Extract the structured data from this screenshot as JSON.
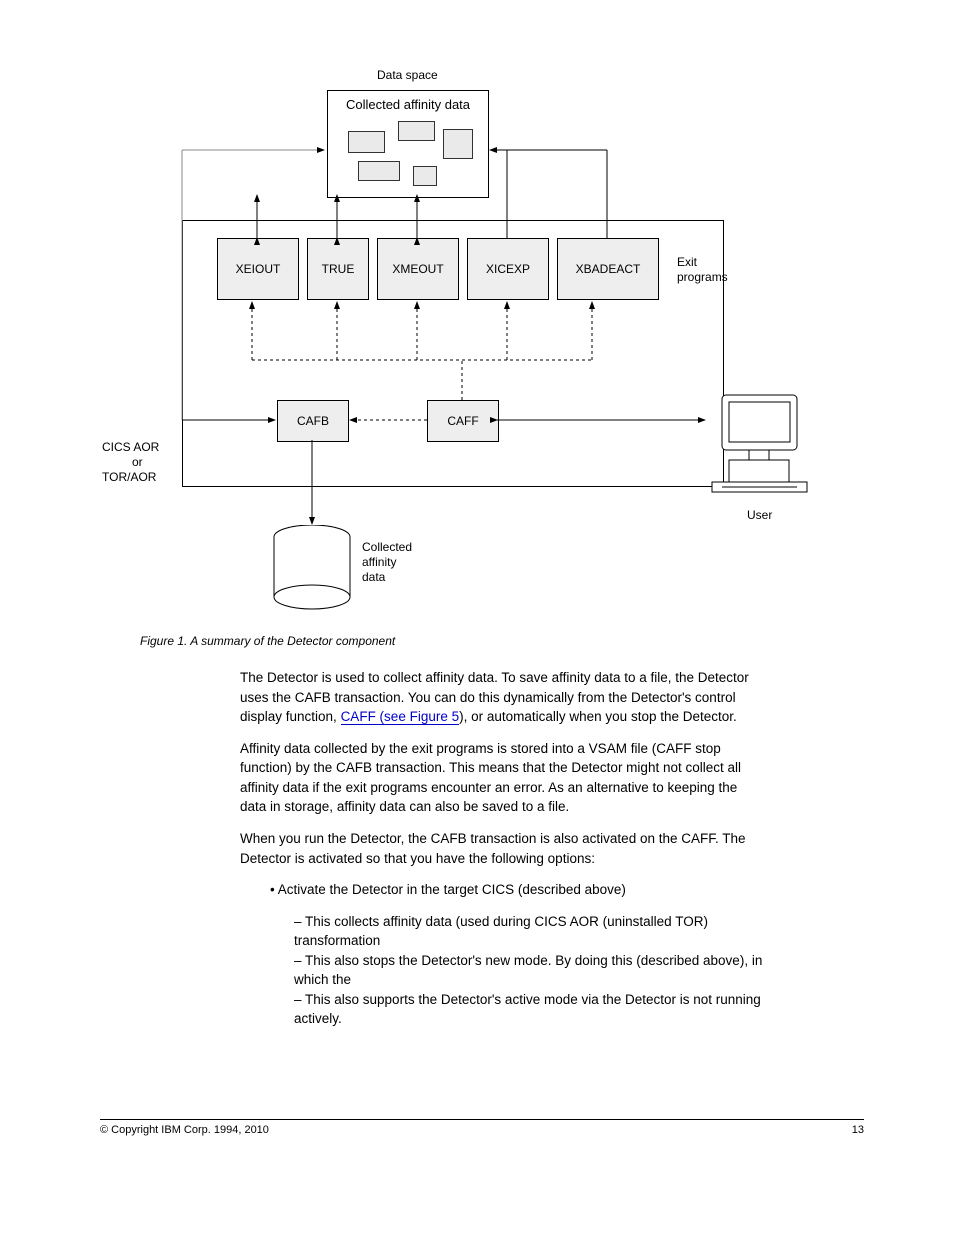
{
  "diagram": {
    "dataspace_title": "Data space",
    "dataspace_inner_label": "Collected affinity data",
    "exit_programs_label_1": "Exit",
    "exit_programs_label_2": "programs",
    "exits": [
      "XEIOUT",
      "TRUE",
      "XMEOUT",
      "XICEXP",
      "XBADEACT"
    ],
    "cafb": "CAFB",
    "caff": "CAFF",
    "left_label_1": "CICS AOR",
    "left_label_2": "or",
    "left_label_3": "TOR/AOR",
    "user_label": "User",
    "cyl_label_1": "Collected",
    "cyl_label_2": "affinity",
    "cyl_label_3": "data"
  },
  "figure_caption": "Figure 1. A summary of the Detector component",
  "paras": {
    "p1a": "The Detector is used to collect affinity data. To save affinity data to a file, the Detector uses the CAFB transaction. You can do this dynamically from the Detector's control display function, ",
    "p1link": "CAFF (see Figure 5",
    "p1b": "), or automatically when you stop the Detector.",
    "p2": "Affinity data collected by the exit programs is stored into a VSAM file (CAFF stop function) by the CAFB transaction. This means that the Detector might not collect all affinity data if the exit programs encounter an error. As an alternative to keeping the data in storage, affinity data can also be saved to a file.",
    "p3": "When you run the Detector, the CAFB transaction is also activated on the CAFF. The Detector is activated so that you have the following options:",
    "bullets": {
      "b1": "Activate the Detector in the target CICS (described above)",
      "b1s1": "This collects affinity data (used during CICS AOR (uninstalled TOR) transformation",
      "b1s2": "This also stops the Detector's new mode. By doing this (described above), in which the",
      "b1s3": "This also supports the Detector's active mode via the Detector is not running actively."
    }
  },
  "footer": {
    "left": "© Copyright IBM Corp. 1994, 2010",
    "right": "13"
  }
}
